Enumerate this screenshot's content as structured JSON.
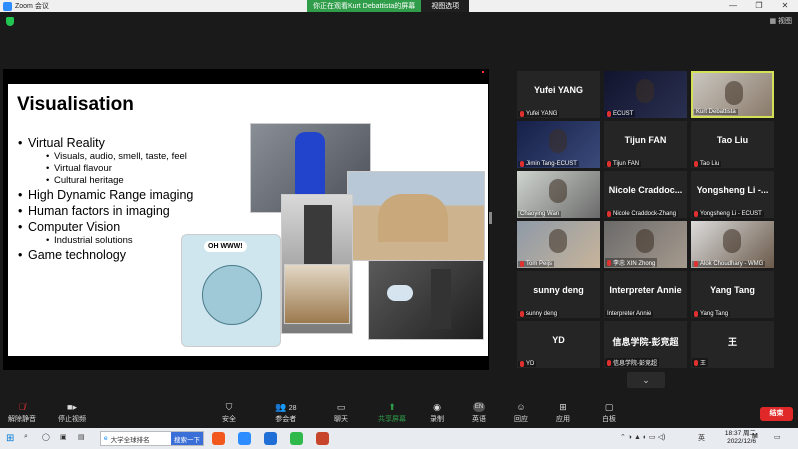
{
  "window": {
    "app_title": "Zoom 会议",
    "share_banner": "你正在观看Kurt  Debattista的屏幕",
    "view_options": "视图选项",
    "controls": [
      "—",
      "❐",
      "✕"
    ]
  },
  "topbar": {
    "view_label": "视图"
  },
  "slide": {
    "title": "Visualisation",
    "bullets": [
      {
        "text": "Virtual Reality",
        "sub": [
          "Visuals, audio, smell, taste, feel",
          "Virtual flavour",
          "Cultural heritage"
        ]
      },
      {
        "text": "High Dynamic Range imaging",
        "sub": []
      },
      {
        "text": "Human factors in imaging",
        "sub": []
      },
      {
        "text": "Computer Vision",
        "sub": [
          "Industrial solutions"
        ]
      },
      {
        "text": "Game technology",
        "sub": []
      }
    ],
    "cartoon_caption": "OH WWW!"
  },
  "participants": [
    {
      "big": "Yufei YANG",
      "label": "Yufei YANG",
      "muted": true,
      "video": false
    },
    {
      "big": "",
      "label": "ECUST",
      "muted": true,
      "video": true,
      "colors": [
        "#11142e",
        "#2a3050"
      ]
    },
    {
      "big": "",
      "label": "Kurt Debattista",
      "muted": false,
      "video": true,
      "active": true,
      "colors": [
        "#c9c6bf",
        "#8a7a6a"
      ]
    },
    {
      "big": "",
      "label": "Jimin Tang-ECUST",
      "muted": true,
      "video": true,
      "colors": [
        "#162048",
        "#3a4a7a"
      ]
    },
    {
      "big": "Tijun FAN",
      "label": "Tijun FAN",
      "muted": true,
      "video": false
    },
    {
      "big": "Tao Liu",
      "label": "Tao Liu",
      "muted": true,
      "video": false
    },
    {
      "big": "",
      "label": "Chaoying Wan",
      "muted": false,
      "video": true,
      "colors": [
        "#cfd4cf",
        "#6a6a6a"
      ]
    },
    {
      "big": "Nicole  Craddoc...",
      "label": "Nicole Craddock-Zhang",
      "muted": true,
      "video": false
    },
    {
      "big": "Yongsheng Li -...",
      "label": "Yongsheng Li - ECUST",
      "muted": true,
      "video": false
    },
    {
      "big": "",
      "label": "Tom Peijs",
      "muted": true,
      "video": true,
      "colors": [
        "#8e9aa8",
        "#c7b49a"
      ]
    },
    {
      "big": "",
      "label": "李忠 XIN Zhong",
      "muted": true,
      "video": true,
      "colors": [
        "#6a6a6a",
        "#a69a8e"
      ]
    },
    {
      "big": "",
      "label": "Alok Choudhary - WMG",
      "muted": true,
      "video": true,
      "colors": [
        "#dcdcdc",
        "#6a5a4a"
      ]
    },
    {
      "big": "sunny deng",
      "label": "sunny deng",
      "muted": true,
      "video": false
    },
    {
      "big": "Interpreter Annie",
      "label": "Interpreter Annie",
      "muted": false,
      "video": false
    },
    {
      "big": "Yang Tang",
      "label": "Yang Tang",
      "muted": true,
      "video": false
    },
    {
      "big": "YD",
      "label": "YD",
      "muted": true,
      "video": false
    },
    {
      "big": "信息学院-彭竞超",
      "label": "信息学院-彭竞超",
      "muted": true,
      "video": false
    },
    {
      "big": "王",
      "label": "王",
      "muted": true,
      "video": false
    }
  ],
  "scroll_down_icon": "chevron-down-icon",
  "toolbar": {
    "unmute": "解除静音",
    "stop_video": "停止视频",
    "security": "安全",
    "participants": "参会者",
    "participants_count": "28",
    "chat": "聊天",
    "share": "共享屏幕",
    "record": "录制",
    "interpret": "英语",
    "interpret_badge": "EN",
    "reactions": "回应",
    "apps": "应用",
    "whiteboard": "白板",
    "end": "结束"
  },
  "taskbar": {
    "search_text": "大学全球排名",
    "search_button": "搜索一下",
    "time": "18:37 周二",
    "date": "2022/12/6",
    "lang": "英"
  },
  "colors": {
    "accent_green": "#2f9d4a",
    "end_red": "#e02828",
    "active_border": "#d4e157"
  }
}
